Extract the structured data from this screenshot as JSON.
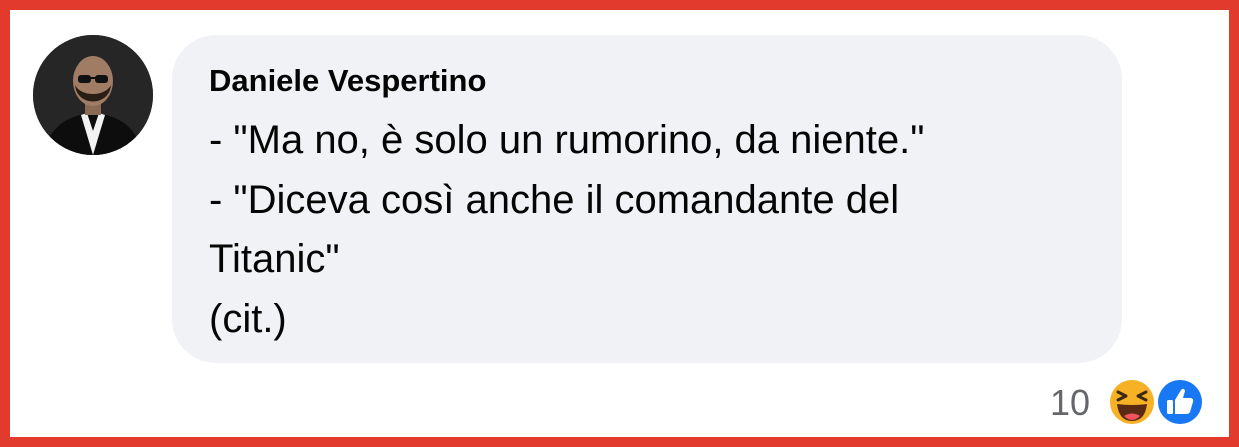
{
  "comment": {
    "author": "Daniele Vespertino",
    "lines": [
      "- \"Ma no, è solo un rumorino, da niente.\"",
      "- \"Diceva così anche il comandante del",
      "Titanic\"",
      "(cit.)"
    ]
  },
  "reactions": {
    "count": "10",
    "icons": [
      "haha-icon",
      "like-icon"
    ]
  },
  "colors": {
    "frame": "#e23b2e",
    "bubble": "#f0f2f5",
    "text": "#050505",
    "count": "#65676b",
    "like": "#1877f2",
    "haha": "#f7b125"
  }
}
